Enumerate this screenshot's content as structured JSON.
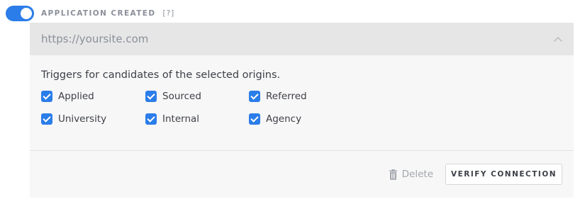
{
  "header": {
    "toggle_on": true,
    "label": "APPLICATION CREATED",
    "help": "[?]"
  },
  "panel": {
    "url": "https://yoursite.com",
    "triggers_text": "Triggers for candidates of the selected origins.",
    "origins": [
      {
        "label": "Applied",
        "checked": true
      },
      {
        "label": "Sourced",
        "checked": true
      },
      {
        "label": "Referred",
        "checked": true
      },
      {
        "label": "University",
        "checked": true
      },
      {
        "label": "Internal",
        "checked": true
      },
      {
        "label": "Agency",
        "checked": true
      }
    ],
    "delete_label": "Delete",
    "verify_label": "VERIFY CONNECTION"
  },
  "colors": {
    "accent": "#2b7de9",
    "panel_bg": "#f7f7f7",
    "url_bar_bg": "#e6e6e6"
  }
}
